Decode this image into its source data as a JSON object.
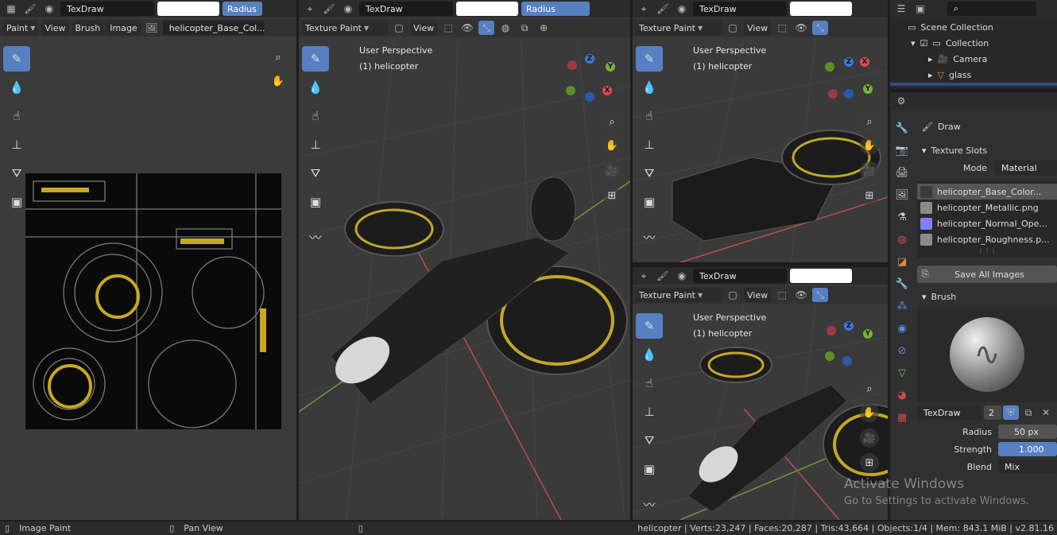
{
  "image_editor": {
    "brush_name": "TexDraw",
    "radius_label": "Radius",
    "mode": "Paint",
    "menu": [
      "View",
      "Brush",
      "Image"
    ],
    "image_name": "helicopter_Base_Col..."
  },
  "viewport_main": {
    "brush_name": "TexDraw",
    "radius_label": "Radius",
    "mode": "Texture Paint",
    "view": "View",
    "perspective": "User Perspective",
    "object": "(1) helicopter"
  },
  "viewport_top_right": {
    "brush_name": "TexDraw",
    "mode": "Texture Paint",
    "view": "View",
    "perspective": "User Perspective",
    "object": "(1) helicopter"
  },
  "viewport_bottom_right": {
    "brush_name": "TexDraw",
    "mode": "Texture Paint",
    "view": "View",
    "perspective": "User Perspective",
    "object": "(1) helicopter"
  },
  "gizmo": {
    "x": "X",
    "y": "Y",
    "z": "Z"
  },
  "outliner": {
    "scene_collection": "Scene Collection",
    "collection": "Collection",
    "camera": "Camera",
    "glass": "glass"
  },
  "properties": {
    "tool": "Draw",
    "texture_slots_header": "Texture Slots",
    "mode_label": "Mode",
    "mode_value": "Material",
    "slots": [
      {
        "name": "helicopter_Base_Color...",
        "color": "#3a3a3a"
      },
      {
        "name": "helicopter_Metallic.png",
        "color": "#8a8a8a"
      },
      {
        "name": "helicopter_Normal_Ope...",
        "color": "#8080ff"
      },
      {
        "name": "helicopter_Roughness.p...",
        "color": "#8a8a8a"
      }
    ],
    "save_all": "Save All Images",
    "brush_header": "Brush",
    "brush_name": "TexDraw",
    "brush_users": "2",
    "radius_label": "Radius",
    "radius_value": "50 px",
    "strength_label": "Strength",
    "strength_value": "1.000",
    "blend_label": "Blend",
    "blend_value": "Mix"
  },
  "watermark": {
    "line1": "Activate Windows",
    "line2": "Go to Settings to activate Windows."
  },
  "status": {
    "left_action": "Image Paint",
    "mid_action": "Pan View",
    "stats": "helicopter | Verts:23,247 | Faces:20,287 | Tris:43,664 | Objects:1/4 | Mem: 843.1 MiB | v2.81.16"
  },
  "colors": {
    "accent": "#5680c2",
    "x_axis": "#e04a57",
    "y_axis": "#7ab234",
    "z_axis": "#3b78d8"
  }
}
